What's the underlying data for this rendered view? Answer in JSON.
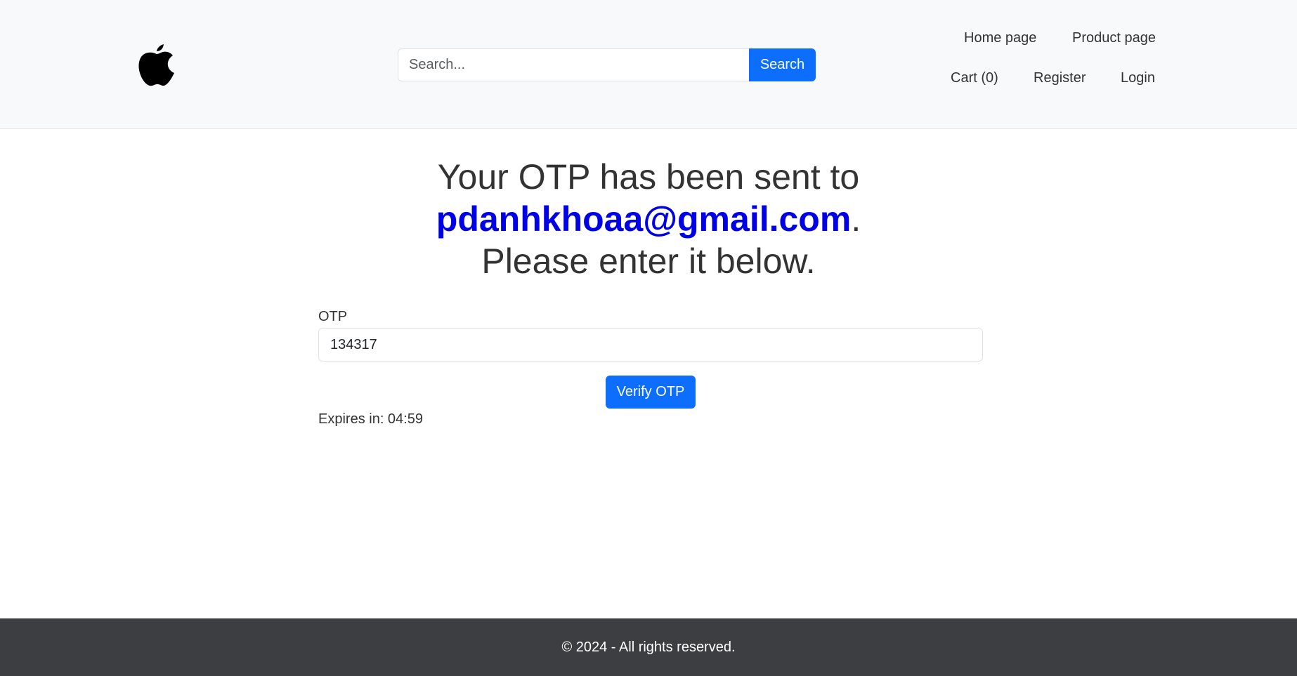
{
  "header": {
    "logo_icon": "apple-logo-icon",
    "search": {
      "placeholder": "Search...",
      "value": "",
      "button_label": "Search"
    },
    "nav": {
      "home": "Home page",
      "product": "Product page",
      "cart": "Cart (0)",
      "register": "Register",
      "login": "Login"
    }
  },
  "main": {
    "title_line1": "Your OTP has been sent to",
    "email": "pdanhkhoaa@gmail.com",
    "email_suffix": ".",
    "title_line3": "Please enter it below.",
    "otp_label": "OTP",
    "otp_value": "134317",
    "verify_label": "Verify OTP",
    "expires_text": "Expires in: 04:59"
  },
  "footer": {
    "text": "© 2024 - All rights reserved."
  },
  "colors": {
    "accent": "#0d6efd",
    "email": "#0000e6",
    "header_bg": "#f8f9fa",
    "footer_bg": "#3d3e42"
  }
}
